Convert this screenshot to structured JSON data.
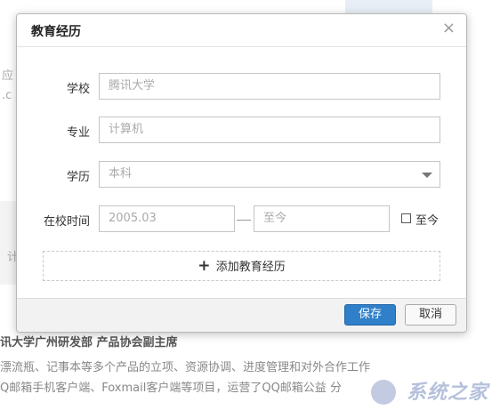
{
  "background": {
    "left_text_1": "应",
    "left_text_2": ".c",
    "panel_text": "计",
    "heading": "讯大学广州研发部   产品协会副主席",
    "line1": "漂流瓶、记事本等多个产品的立项、资源协调、进度管理和对外合作工作",
    "line2": "Q邮箱手机客户端、Foxmail客户端等项目，运营了QQ邮箱公益 分",
    "watermark": "系统之家"
  },
  "dialog": {
    "title": "教育经历",
    "close_glyph": "×",
    "school": {
      "label": "学校",
      "placeholder": "腾讯大学"
    },
    "major": {
      "label": "专业",
      "placeholder": "计算机"
    },
    "degree": {
      "label": "学历",
      "value": "本科"
    },
    "period": {
      "label": "在校时间",
      "start": "2005.03",
      "end": "至今",
      "checkbox_label": "至今",
      "checked": false
    },
    "add": {
      "plus": "+",
      "label": "添加教育经历"
    },
    "footer": {
      "save_label": "保存",
      "cancel_label": "取消"
    }
  },
  "colors": {
    "primary_button": "#2f7fc9",
    "footer_bg": "#f2f2f2"
  }
}
